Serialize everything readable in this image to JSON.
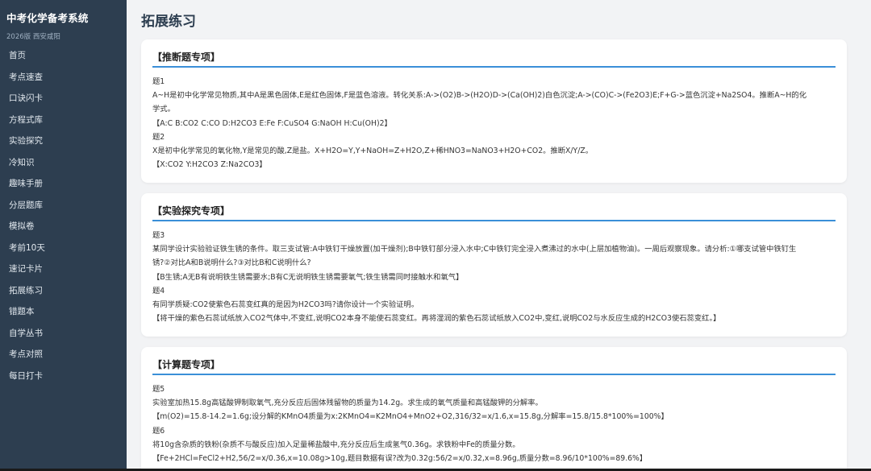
{
  "sidebar": {
    "title": "中考化学备考系统",
    "subtitle": "2026版 西安咸阳",
    "items": [
      {
        "label": "首页"
      },
      {
        "label": "考点速查"
      },
      {
        "label": "口诀闪卡"
      },
      {
        "label": "方程式库"
      },
      {
        "label": "实验探究"
      },
      {
        "label": "冷知识"
      },
      {
        "label": "趣味手册"
      },
      {
        "label": "分层题库"
      },
      {
        "label": "模拟卷"
      },
      {
        "label": "考前10天"
      },
      {
        "label": "速记卡片"
      },
      {
        "label": "拓展练习"
      },
      {
        "label": "错题本"
      },
      {
        "label": "自学丛书"
      },
      {
        "label": "考点对照"
      },
      {
        "label": "每日打卡"
      }
    ]
  },
  "main": {
    "title": "拓展练习",
    "sections": [
      {
        "heading": "【推断题专项】",
        "lines": [
          "题1",
          "A~H是初中化学常见物质,其中A是黑色固体,E是红色固体,F是蓝色溶液。转化关系:A->(O2)B->(H2O)D->(Ca(OH)2)白色沉淀;A->(CO)C->(Fe2O3)E;F+G->蓝色沉淀+Na2SO4。推断A~H的化",
          "学式。",
          "【A:C B:CO2 C:CO D:H2CO3 E:Fe F:CuSO4 G:NaOH H:Cu(OH)2】",
          "题2",
          "X是初中化学常见的氧化物,Y是常见的酸,Z是盐。X+H2O=Y,Y+NaOH=Z+H2O,Z+稀HNO3=NaNO3+H2O+CO2。推断X/Y/Z。",
          "【X:CO2 Y:H2CO3 Z:Na2CO3】"
        ]
      },
      {
        "heading": "【实验探究专项】",
        "lines": [
          "题3",
          "某同学设计实验验证铁生锈的条件。取三支试管:A中铁钉干燥放置(加干燥剂);B中铁钉部分浸入水中;C中铁钉完全浸入煮沸过的水中(上层加植物油)。一周后观察现象。请分析:①哪支试管中铁钉生",
          "锈?②对比A和B说明什么?③对比B和C说明什么?",
          "【B生锈;A无B有说明铁生锈需要水;B有C无说明铁生锈需要氧气;铁生锈需同时接触水和氧气】",
          "题4",
          "有同学质疑:CO2使紫色石蕊变红真的是因为H2CO3吗?请你设计一个实验证明。",
          "【将干燥的紫色石蕊试纸放入CO2气体中,不变红,说明CO2本身不能使石蕊变红。再将湿润的紫色石蕊试纸放入CO2中,变红,说明CO2与水反应生成的H2CO3使石蕊变红。】"
        ]
      },
      {
        "heading": "【计算题专项】",
        "lines": [
          "题5",
          "实验室加热15.8g高锰酸钾制取氧气,充分反应后固体残留物的质量为14.2g。求生成的氧气质量和高锰酸钾的分解率。",
          "【m(O2)=15.8-14.2=1.6g;设分解的KMnO4质量为x:2KMnO4=K2MnO4+MnO2+O2,316/32=x/1.6,x=15.8g,分解率=15.8/15.8*100%=100%】",
          "题6",
          "将10g含杂质的铁粉(杂质不与酸反应)加入足量稀盐酸中,充分反应后生成氢气0.36g。求铁粉中Fe的质量分数。",
          "【Fe+2HCl=FeCl2+H2,56/2=x/0.36,x=10.08g>10g,题目数据有误?改为0.32g:56/2=x/0.32,x=8.96g,质量分数=8.96/10*100%=89.6%】"
        ]
      }
    ]
  }
}
